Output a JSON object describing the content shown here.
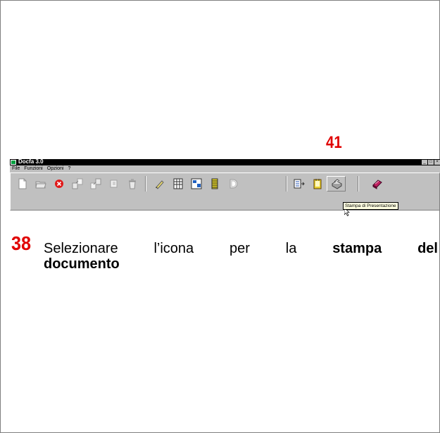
{
  "callout_number": "41",
  "window": {
    "title": "Docfa 3.0",
    "controls": [
      "_",
      "□",
      "×"
    ]
  },
  "menu": [
    {
      "label": "File"
    },
    {
      "label": "Funzioni"
    },
    {
      "label": "Opzioni"
    },
    {
      "label": "?"
    }
  ],
  "toolbar": {
    "buttons": [
      {
        "name": "new-document-icon"
      },
      {
        "name": "open-folder-icon"
      },
      {
        "name": "delete-icon"
      },
      {
        "name": "export-icon"
      },
      {
        "name": "import-icon"
      },
      {
        "name": "copy-icon"
      },
      {
        "name": "recycle-icon"
      },
      {
        "name": "edit-pencil-icon"
      },
      {
        "name": "grid-form-icon"
      },
      {
        "name": "form-layout-icon"
      },
      {
        "name": "stack-icon"
      },
      {
        "name": "d-shape-icon"
      },
      {
        "name": "list-arrow-icon"
      },
      {
        "name": "notepad-icon"
      },
      {
        "name": "printer-icon"
      },
      {
        "name": "book-icon"
      }
    ],
    "tooltip": "Stampa di Presentazione"
  },
  "instruction": {
    "step_number": "38",
    "words": [
      "Selezionare",
      "l’icona",
      "per",
      "la"
    ],
    "bold_words": [
      "stampa",
      "del"
    ],
    "line2_bold": "documento"
  },
  "colors": {
    "accent_red": "#e00000",
    "toolbar_bg": "#c0c0c0",
    "title_bar": "#000000"
  }
}
